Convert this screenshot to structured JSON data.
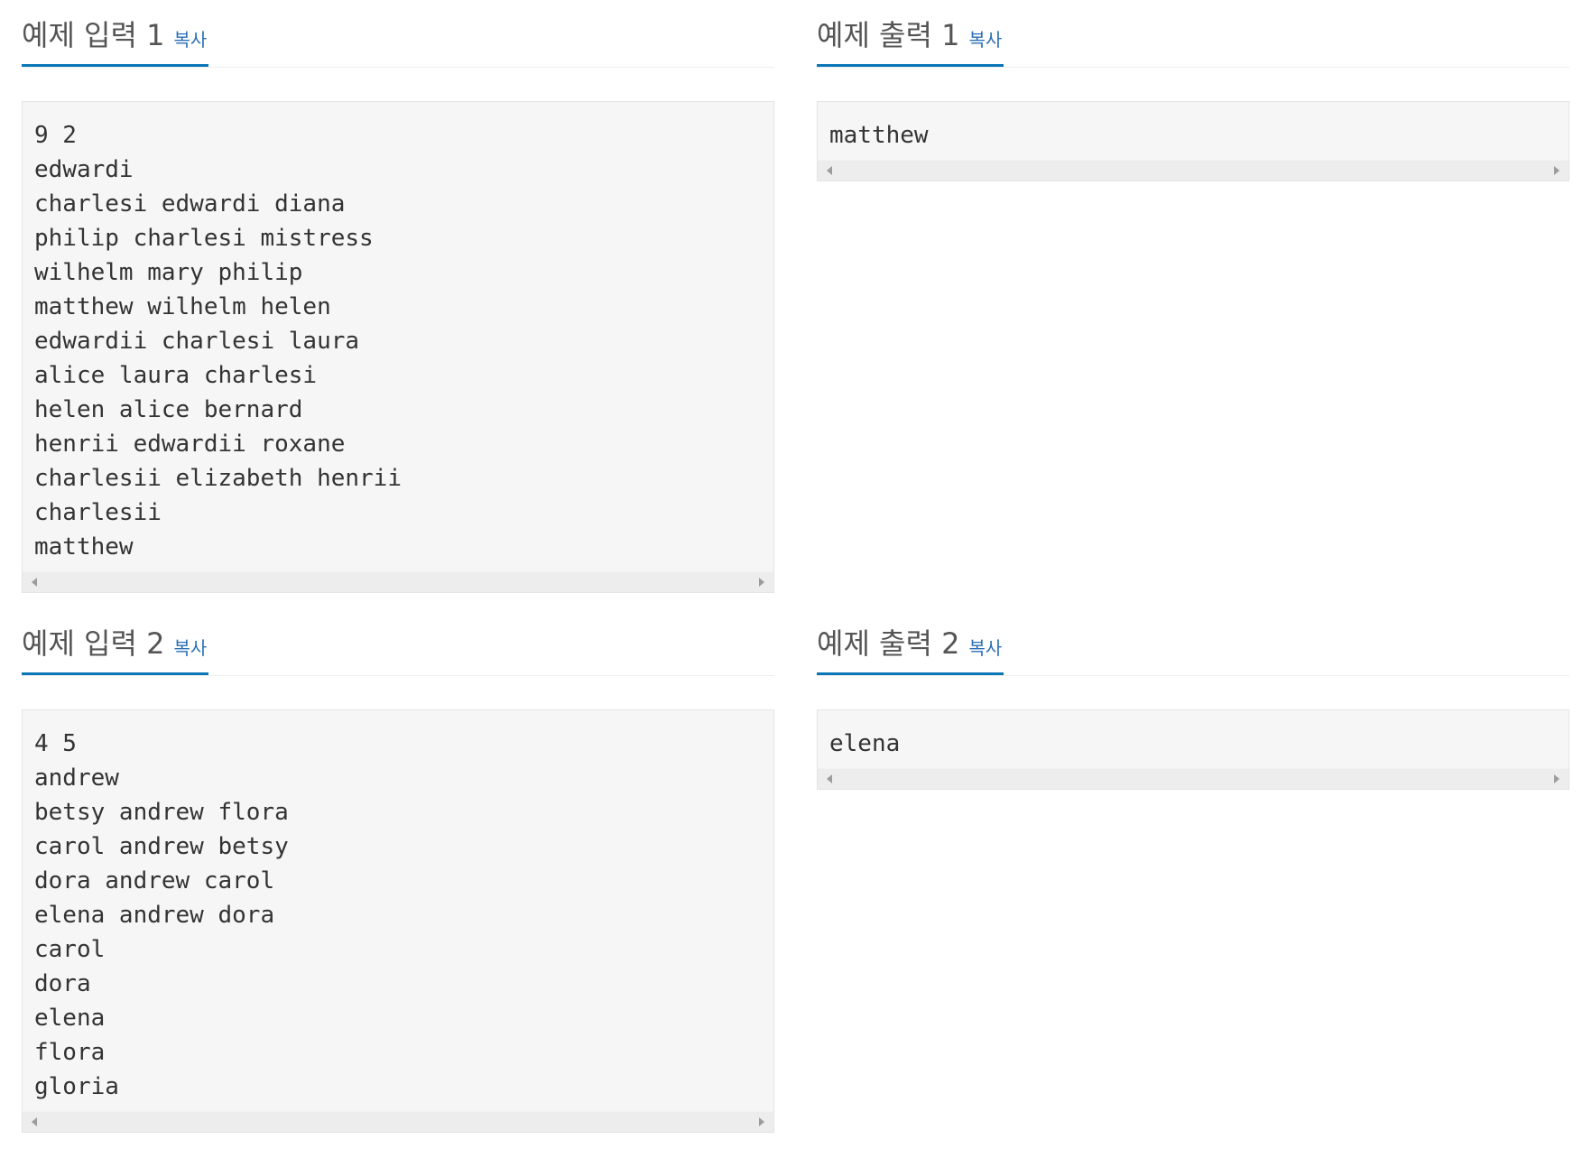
{
  "copy_label": "복사",
  "sample_input_1": {
    "title": "예제 입력 1",
    "lines": [
      "9 2",
      "edwardi",
      "charlesi edwardi diana",
      "philip charlesi mistress",
      "wilhelm mary philip",
      "matthew wilhelm helen",
      "edwardii charlesi laura",
      "alice laura charlesi",
      "helen alice bernard",
      "henrii edwardii roxane",
      "charlesii elizabeth henrii",
      "charlesii",
      "matthew"
    ]
  },
  "sample_output_1": {
    "title": "예제 출력 1",
    "lines": [
      "matthew"
    ]
  },
  "sample_input_2": {
    "title": "예제 입력 2",
    "lines": [
      "4 5",
      "andrew",
      "betsy andrew flora",
      "carol andrew betsy",
      "dora andrew carol",
      "elena andrew dora",
      "carol",
      "dora",
      "elena",
      "flora",
      "gloria"
    ]
  },
  "sample_output_2": {
    "title": "예제 출력 2",
    "lines": [
      "elena"
    ]
  },
  "colors": {
    "accent_underline": "#0a76b7",
    "copy_link": "#2a6fb5",
    "pre_background": "#f6f6f7"
  },
  "icons": [
    "scroll-left-arrow-icon",
    "scroll-right-arrow-icon"
  ]
}
